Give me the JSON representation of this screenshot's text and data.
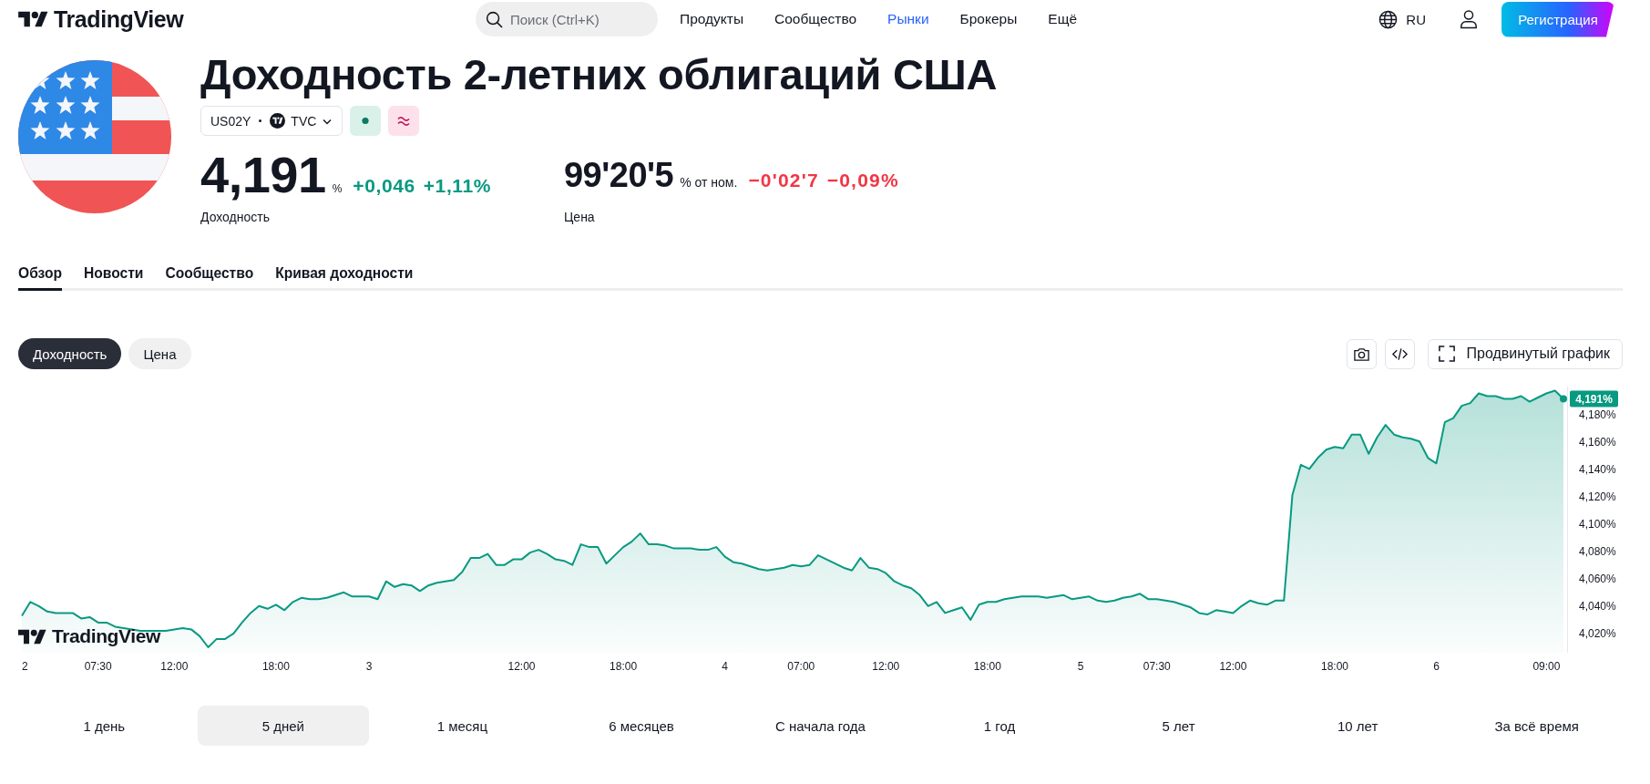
{
  "header": {
    "logo": "TradingView",
    "search": {
      "placeholder": "Поиск (Ctrl+K)"
    },
    "nav": [
      {
        "label": "Продукты",
        "selected": false
      },
      {
        "label": "Сообщество",
        "selected": false
      },
      {
        "label": "Рынки",
        "selected": true
      },
      {
        "label": "Брокеры",
        "selected": false
      },
      {
        "label": "Ещё",
        "selected": false
      }
    ],
    "language": "RU",
    "signup_button": "Регистрация"
  },
  "symbol": {
    "title": "Доходность 2-летних облигаций США",
    "ticker": "US02Y",
    "exchange": "TVC",
    "quotes": [
      {
        "value": "4,191",
        "unit": "%",
        "change": "+0,046",
        "change_percent": "+1,11%",
        "label": "Доходность",
        "color": "#089981"
      },
      {
        "value": "99'20'5",
        "unit": "% от ном.",
        "change": "−0'02'7",
        "change_percent": "−0,09%",
        "label": "Цена",
        "color": "#f23645"
      }
    ]
  },
  "tabs": [
    {
      "label": "Обзор",
      "selected": true
    },
    {
      "label": "Новости",
      "selected": false
    },
    {
      "label": "Сообщество",
      "selected": false
    },
    {
      "label": "Кривая доходности",
      "selected": false
    }
  ],
  "chart": {
    "modes": [
      {
        "label": "Доходность",
        "selected": true
      },
      {
        "label": "Цена",
        "selected": false
      }
    ],
    "advanced_button": "Продвинутый график",
    "logo": "TradingView",
    "last_value_label": "4,191%",
    "chart_data": {
      "type": "area",
      "ylim": [
        4.006,
        4.2
      ],
      "yticks": [
        {
          "value": 4.02,
          "label": "4,020%"
        },
        {
          "value": 4.04,
          "label": "4,040%"
        },
        {
          "value": 4.06,
          "label": "4,060%"
        },
        {
          "value": 4.08,
          "label": "4,080%"
        },
        {
          "value": 4.1,
          "label": "4,100%"
        },
        {
          "value": 4.12,
          "label": "4,120%"
        },
        {
          "value": 4.14,
          "label": "4,140%"
        },
        {
          "value": 4.16,
          "label": "4,160%"
        },
        {
          "value": 4.18,
          "label": "4,180%"
        }
      ],
      "categories": [
        "2",
        null,
        null,
        null,
        null,
        null,
        null,
        null,
        null,
        "07:30",
        null,
        null,
        null,
        null,
        null,
        null,
        null,
        null,
        "12:00",
        null,
        null,
        null,
        null,
        null,
        null,
        null,
        null,
        null,
        null,
        null,
        "18:00",
        null,
        null,
        null,
        null,
        null,
        null,
        null,
        null,
        null,
        null,
        "3",
        null,
        null,
        null,
        null,
        null,
        null,
        null,
        null,
        null,
        null,
        null,
        null,
        null,
        null,
        null,
        null,
        null,
        "12:00",
        null,
        null,
        null,
        null,
        null,
        null,
        null,
        null,
        null,
        null,
        null,
        "18:00",
        null,
        null,
        null,
        null,
        null,
        null,
        null,
        null,
        null,
        null,
        null,
        "4",
        null,
        null,
        null,
        null,
        null,
        null,
        null,
        null,
        "07:00",
        null,
        null,
        null,
        null,
        null,
        null,
        null,
        null,
        null,
        "12:00",
        null,
        null,
        null,
        null,
        null,
        null,
        null,
        null,
        null,
        null,
        null,
        "18:00",
        null,
        null,
        null,
        null,
        null,
        null,
        null,
        null,
        null,
        null,
        "5",
        null,
        null,
        null,
        null,
        null,
        null,
        null,
        null,
        "07:30",
        null,
        null,
        null,
        null,
        null,
        null,
        null,
        null,
        "12:00",
        null,
        null,
        null,
        null,
        null,
        null,
        null,
        null,
        null,
        null,
        null,
        "18:00",
        null,
        null,
        null,
        null,
        null,
        null,
        null,
        null,
        null,
        null,
        null,
        "6",
        null,
        null,
        null,
        null,
        null,
        null,
        null,
        null,
        null,
        null,
        null,
        null,
        "09:00",
        null,
        null
      ],
      "series": [
        {
          "color": "#089981",
          "values": [
            4.033,
            4.043,
            4.04,
            4.036,
            4.035,
            4.035,
            4.035,
            4.031,
            4.032,
            4.028,
            4.028,
            4.025,
            4.024,
            4.023,
            4.022,
            4.022,
            4.022,
            4.022,
            4.023,
            4.024,
            4.023,
            4.018,
            4.01,
            4.016,
            4.016,
            4.02,
            4.028,
            4.035,
            4.04,
            4.038,
            4.041,
            4.037,
            4.043,
            4.046,
            4.045,
            4.045,
            4.046,
            4.048,
            4.05,
            4.047,
            4.047,
            4.047,
            4.045,
            4.058,
            4.054,
            4.056,
            4.055,
            4.051,
            4.055,
            4.057,
            4.058,
            4.059,
            4.065,
            4.075,
            4.075,
            4.078,
            4.07,
            4.07,
            4.074,
            4.074,
            4.079,
            4.081,
            4.078,
            4.074,
            4.073,
            4.07,
            4.085,
            4.083,
            4.083,
            4.071,
            4.077,
            4.083,
            4.087,
            4.093,
            4.085,
            4.085,
            4.084,
            4.082,
            4.082,
            4.082,
            4.081,
            4.081,
            4.083,
            4.076,
            4.072,
            4.071,
            4.069,
            4.067,
            4.066,
            4.067,
            4.068,
            4.07,
            4.069,
            4.07,
            4.077,
            4.074,
            4.071,
            4.068,
            4.066,
            4.075,
            4.068,
            4.067,
            4.064,
            4.058,
            4.055,
            4.053,
            4.048,
            4.04,
            4.043,
            4.035,
            4.037,
            4.039,
            4.03,
            4.041,
            4.043,
            4.043,
            4.045,
            4.046,
            4.047,
            4.047,
            4.047,
            4.046,
            4.047,
            4.048,
            4.045,
            4.046,
            4.047,
            4.044,
            4.043,
            4.044,
            4.046,
            4.047,
            4.049,
            4.045,
            4.045,
            4.044,
            4.043,
            4.041,
            4.039,
            4.035,
            4.034,
            4.037,
            4.036,
            4.035,
            4.04,
            4.044,
            4.042,
            4.041,
            4.044,
            4.044,
            4.121,
            4.143,
            4.14,
            4.148,
            4.154,
            4.156,
            4.155,
            4.165,
            4.165,
            4.151,
            4.163,
            4.172,
            4.165,
            4.163,
            4.162,
            4.16,
            4.148,
            4.144,
            4.174,
            4.177,
            4.186,
            4.188,
            4.195,
            4.193,
            4.193,
            4.191,
            4.191,
            4.193,
            4.189,
            4.192,
            4.195,
            4.197,
            4.191
          ]
        }
      ]
    }
  },
  "ranges": [
    {
      "label": "1 день",
      "selected": false
    },
    {
      "label": "5 дней",
      "selected": true
    },
    {
      "label": "1 месяц",
      "selected": false
    },
    {
      "label": "6 месяцев",
      "selected": false
    },
    {
      "label": "С начала года",
      "selected": false
    },
    {
      "label": "1 год",
      "selected": false
    },
    {
      "label": "5 лет",
      "selected": false
    },
    {
      "label": "10 лет",
      "selected": false
    },
    {
      "label": "За всё время",
      "selected": false
    }
  ]
}
